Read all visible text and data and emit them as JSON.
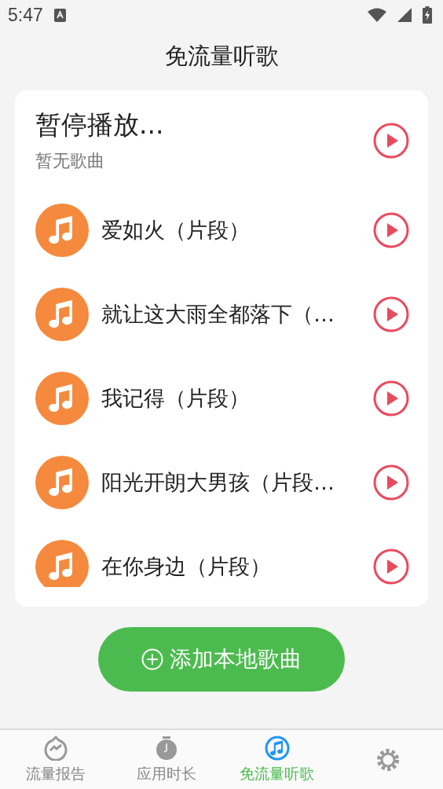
{
  "status_bar": {
    "time": "5:47"
  },
  "title": "免流量听歌",
  "player": {
    "title": "暂停播放...",
    "subtitle": "暂无歌曲"
  },
  "songs": [
    {
      "title": "爱如火（片段）"
    },
    {
      "title": "就让这大雨全都落下（…"
    },
    {
      "title": "我记得（片段）"
    },
    {
      "title": "阳光开朗大男孩（片段…"
    },
    {
      "title": "在你身边（片段）"
    }
  ],
  "add_button": {
    "label": "添加本地歌曲"
  },
  "nav": [
    {
      "kind": "report",
      "label": "流量报告",
      "selected": false
    },
    {
      "kind": "timer",
      "label": "应用时长",
      "selected": false
    },
    {
      "kind": "music",
      "label": "免流量听歌",
      "selected": true
    },
    {
      "kind": "settings",
      "selected": false
    }
  ]
}
